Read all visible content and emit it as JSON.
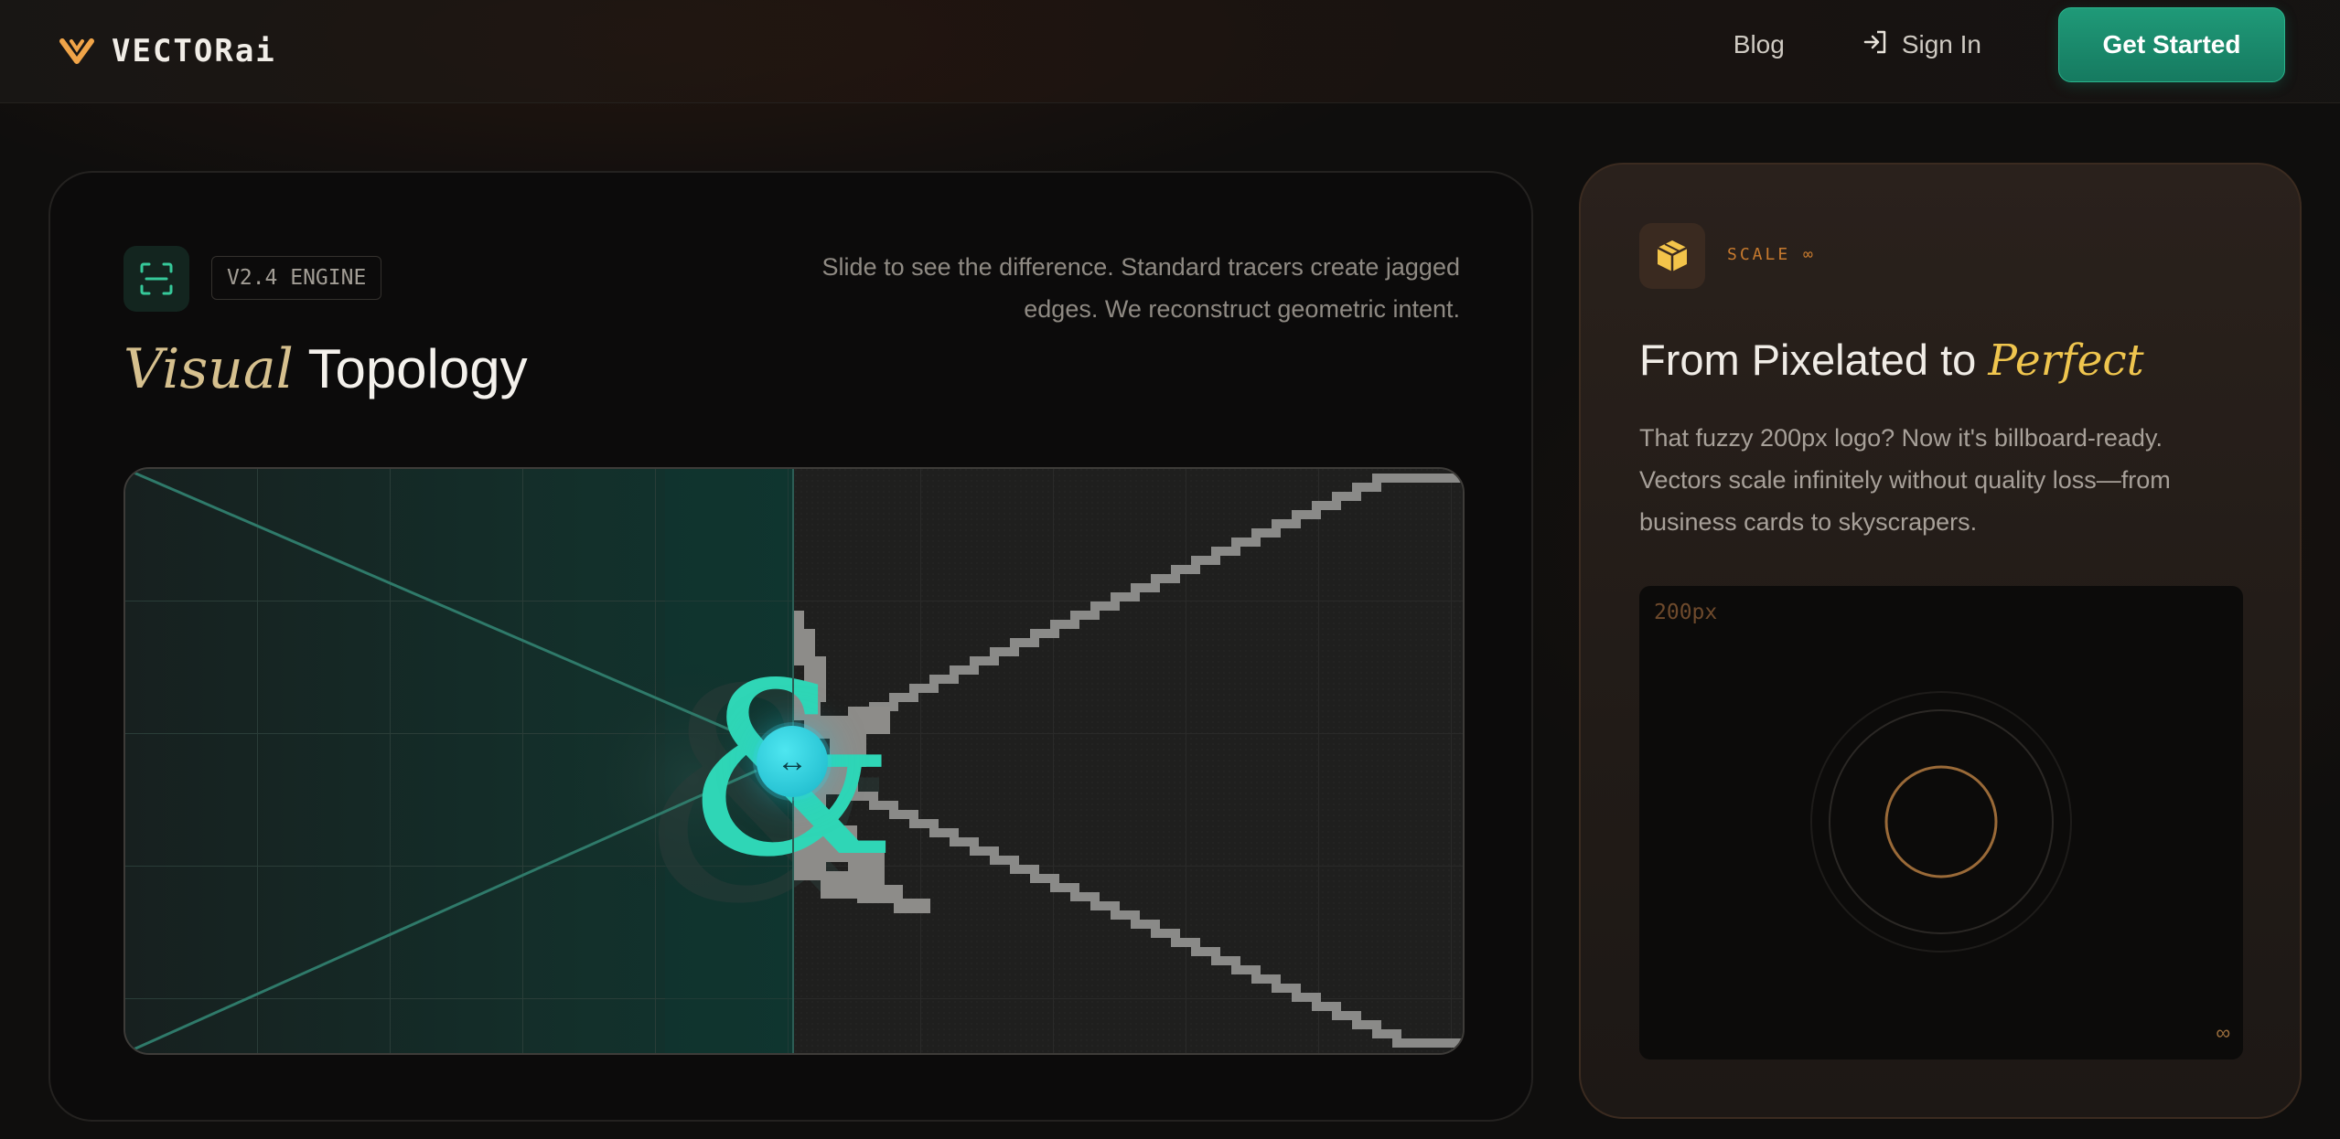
{
  "nav": {
    "brand": "VECTORai",
    "blog": "Blog",
    "sign_in": "Sign In",
    "cta": "Get Started",
    "colors": {
      "brand_accent": "#f0a448",
      "cta_bg": "#1c8f71"
    }
  },
  "topology": {
    "badge": "V2.4 ENGINE",
    "title_accent": "Visual",
    "title_rest": " Topology",
    "description": "Slide to see the difference. Standard tracers create jagged edges. We reconstruct geometric intent.",
    "icon": "scan-icon",
    "slider": {
      "position_percent": 50,
      "handle_icon": "↔"
    },
    "glyph": "&"
  },
  "scale": {
    "badge": "SCALE ∞",
    "title_lead": "From Pixelated to ",
    "title_accent": "Perfect",
    "description": "That fuzzy 200px logo? Now it's billboard-ready. Vectors scale infinitely without quality loss—from business cards to skyscrapers.",
    "preview_size_label": "200px",
    "preview_inf_label": "∞",
    "icon": "cube-icon",
    "colors": {
      "accent": "#efc54e",
      "badge": "#c77a2e"
    }
  }
}
